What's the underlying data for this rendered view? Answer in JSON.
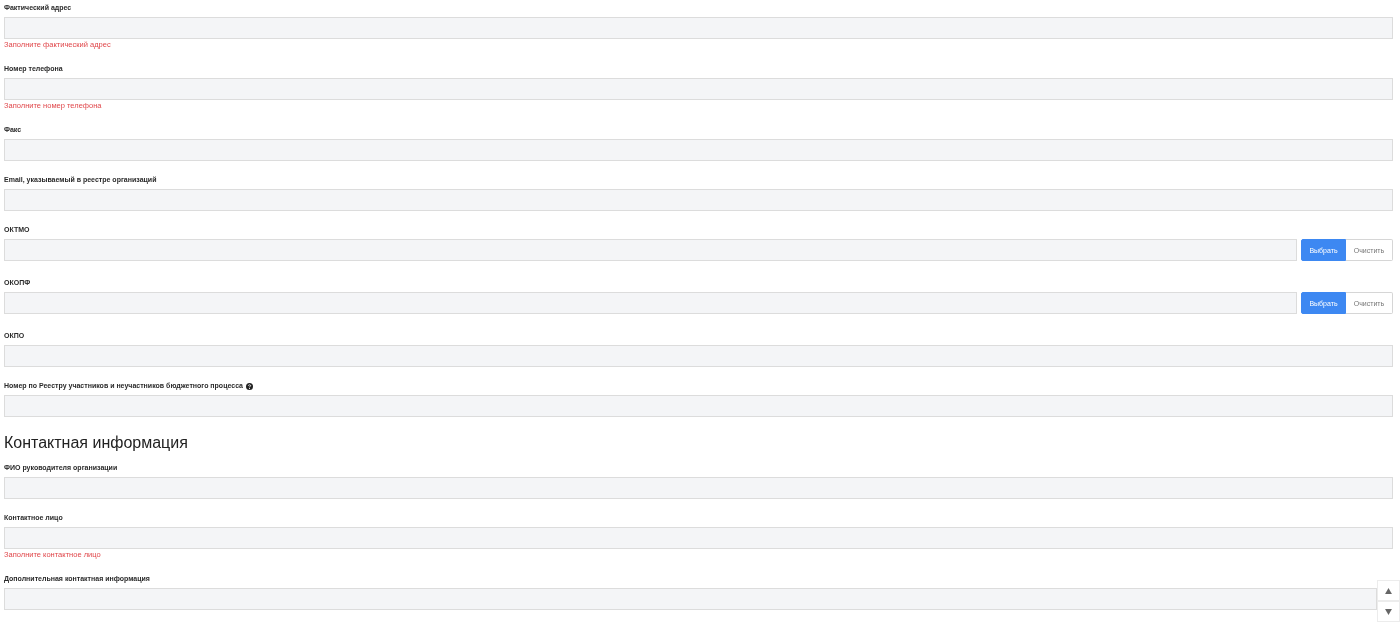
{
  "form": {
    "fields": [
      {
        "label": "Фактический адрес",
        "kind": "text",
        "error": "Заполните фактический адрес"
      },
      {
        "label": "Номер телефона",
        "kind": "text",
        "error": "Заполните номер телефона"
      },
      {
        "label": "Факс",
        "kind": "text"
      },
      {
        "label": "Email, указываемый в реестре организаций",
        "kind": "text"
      },
      {
        "label": "ОКТМО",
        "kind": "picker",
        "buttons": [
          {
            "label": "Выбрать",
            "kind": "primary"
          },
          {
            "label": "Очистить",
            "kind": "secondary"
          }
        ]
      },
      {
        "label": "ОКОПФ",
        "kind": "picker",
        "buttons": [
          {
            "label": "Выбрать",
            "kind": "primary"
          },
          {
            "label": "Очистить",
            "kind": "secondary"
          }
        ]
      },
      {
        "label": "ОКПО",
        "kind": "text"
      },
      {
        "label": "Номер по Реестру участников и неучастников бюджетного процесса",
        "kind": "text",
        "help": true
      }
    ]
  },
  "contact_section": {
    "heading": "Контактная информация",
    "fields": [
      {
        "label": "ФИО руководителя организации",
        "kind": "text"
      },
      {
        "label": "Контактное лицо",
        "kind": "text",
        "error": "Заполните контактное лицо"
      },
      {
        "label": "Дополнительная контактная информация",
        "kind": "text"
      }
    ]
  }
}
